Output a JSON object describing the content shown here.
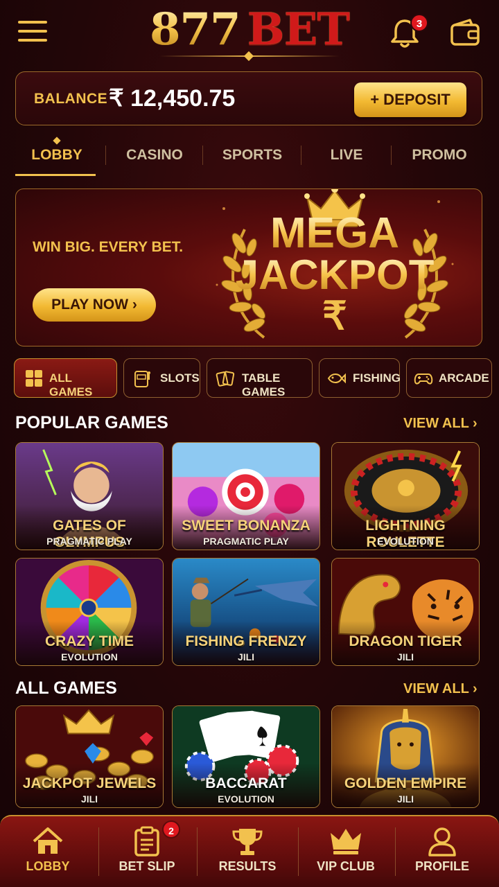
{
  "header": {
    "logo_number": "877",
    "logo_brand": "BET",
    "notifications_count": "3"
  },
  "balance": {
    "label": "BALANCE",
    "amount": "₹ 12,450.75",
    "deposit_label": "+ DEPOSIT"
  },
  "tabs": [
    {
      "label": "LOBBY",
      "active": true
    },
    {
      "label": "CASINO"
    },
    {
      "label": "SPORTS"
    },
    {
      "label": "LIVE"
    },
    {
      "label": "PROMO"
    }
  ],
  "banner": {
    "tagline": "WIN BIG. EVERY BET.",
    "cta": "PLAY NOW  ›",
    "headline_1": "MEGA",
    "headline_2": "JACKPOT",
    "currency_symbol": "₹"
  },
  "categories": [
    {
      "label": "ALL GAMES",
      "icon": "grid-icon",
      "active": true
    },
    {
      "label": "SLOTS",
      "icon": "slot-machine-icon"
    },
    {
      "label": "TABLE GAMES",
      "icon": "cards-icon"
    },
    {
      "label": "FISHING",
      "icon": "fish-icon"
    },
    {
      "label": "ARCADE",
      "icon": "gamepad-icon"
    }
  ],
  "popular": {
    "title": "POPULAR GAMES",
    "view_all": "VIEW ALL  ›",
    "games": [
      {
        "title": "GATES OF OLYMPUS",
        "provider": "PRAGMATIC PLAY"
      },
      {
        "title": "SWEET BONANZA",
        "provider": "PRAGMATIC PLAY"
      },
      {
        "title": "LIGHTNING ROULETTE",
        "provider": "EVOLUTION"
      },
      {
        "title": "CRAZY TIME",
        "provider": "EVOLUTION"
      },
      {
        "title": "FISHING FRENZY",
        "provider": "JILI"
      },
      {
        "title": "DRAGON TIGER",
        "provider": "JILI"
      }
    ]
  },
  "all_games": {
    "title": "ALL GAMES",
    "view_all": "VIEW ALL  ›",
    "games": [
      {
        "title": "JACKPOT JEWELS",
        "provider": "JILI"
      },
      {
        "title": "BACCARAT",
        "provider": "EVOLUTION"
      },
      {
        "title": "GOLDEN EMPIRE",
        "provider": "JILI"
      }
    ]
  },
  "bottom_nav": [
    {
      "label": "LOBBY",
      "icon": "home-icon",
      "active": true
    },
    {
      "label": "BET SLIP",
      "icon": "clipboard-icon",
      "badge": "2"
    },
    {
      "label": "RESULTS",
      "icon": "trophy-icon"
    },
    {
      "label": "VIP CLUB",
      "icon": "crown-icon"
    },
    {
      "label": "PROFILE",
      "icon": "user-icon"
    }
  ],
  "colors": {
    "accent_gold": "#f2c14e",
    "brand_red": "#d01a1a",
    "background": "#220608",
    "badge_red": "#e0181f"
  }
}
